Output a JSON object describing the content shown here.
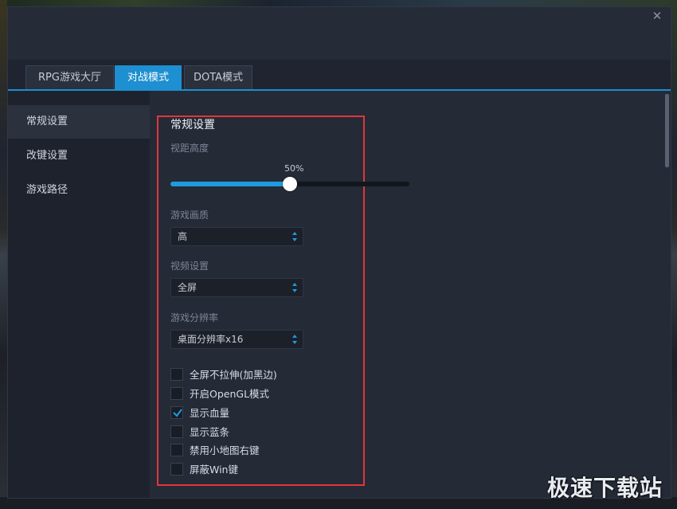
{
  "tabs": [
    {
      "label": "RPG游戏大厅",
      "active": false
    },
    {
      "label": "对战模式",
      "active": true
    },
    {
      "label": "DOTA模式",
      "active": false
    }
  ],
  "sidebar": {
    "items": [
      {
        "label": "常规设置",
        "active": true
      },
      {
        "label": "改键设置",
        "active": false
      },
      {
        "label": "游戏路径",
        "active": false
      }
    ]
  },
  "settings": {
    "heading": "常规设置",
    "view_height": {
      "label": "视距高度",
      "value_text": "50%",
      "value": 0.5
    },
    "quality": {
      "label": "游戏画质",
      "selected": "高"
    },
    "video": {
      "label": "视频设置",
      "selected": "全屏"
    },
    "resolution": {
      "label": "游戏分辨率",
      "selected": "桌面分辨率x16"
    },
    "checkboxes": [
      {
        "label": "全屏不拉伸(加黑边)",
        "checked": false
      },
      {
        "label": "开启OpenGL模式",
        "checked": false
      },
      {
        "label": "显示血量",
        "checked": true
      },
      {
        "label": "显示蓝条",
        "checked": false
      },
      {
        "label": "禁用小地图右键",
        "checked": false
      },
      {
        "label": "屏蔽Win键",
        "checked": false
      }
    ]
  },
  "colors": {
    "accent": "#1e8fd0",
    "highlight_box": "#e2353d"
  },
  "watermark": "极速下载站"
}
